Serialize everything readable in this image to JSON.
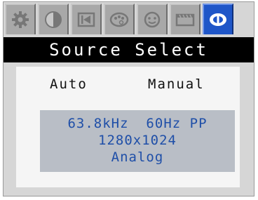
{
  "tabs": [
    {
      "icon": "gear-icon",
      "active": false
    },
    {
      "icon": "contrast-icon",
      "active": false
    },
    {
      "icon": "geometry-icon",
      "active": false
    },
    {
      "icon": "color-palette-icon",
      "active": false
    },
    {
      "icon": "face-icon",
      "active": false
    },
    {
      "icon": "film-icon",
      "active": false
    },
    {
      "icon": "source-input-icon",
      "active": true
    }
  ],
  "menu": {
    "title": "Source Select"
  },
  "options": {
    "auto_label": "Auto",
    "manual_label": "Manual"
  },
  "signal": {
    "line1": "63.8kHz  60Hz PP",
    "resolution": "1280x1024",
    "input_type": "Analog"
  },
  "colors": {
    "active_tab": "#1f56c8",
    "info_text": "#1f4fa8",
    "title_bg": "#000000"
  }
}
